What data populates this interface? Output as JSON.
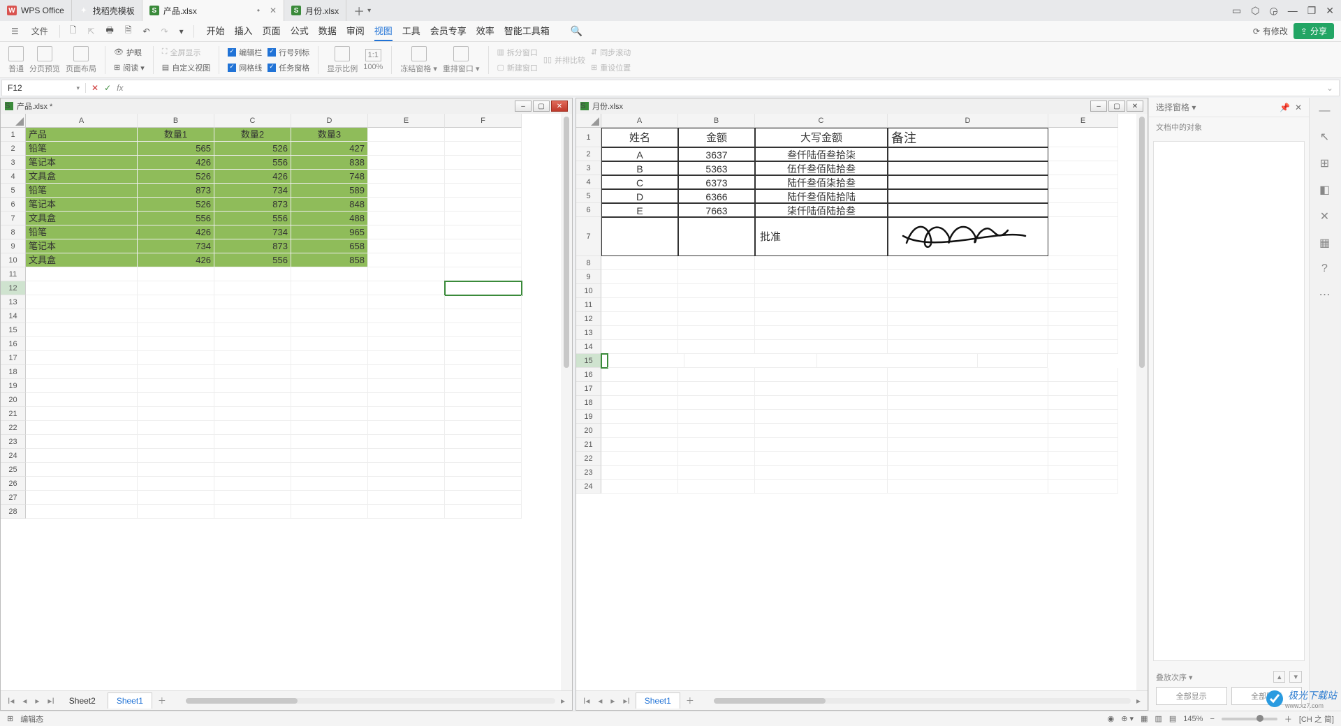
{
  "appTabs": {
    "t0": "WPS Office",
    "t1": "找稻壳模板",
    "t2": "产品.xlsx",
    "t3": "月份.xlsx",
    "dirty2": "•"
  },
  "windowIcons": {
    "min": "—",
    "restore": "❐",
    "close": "✕",
    "help": "?",
    "cube": "⬚",
    "person": "◐",
    "app": "▢"
  },
  "fileMenu": "文件",
  "menuTabs": {
    "m0": "开始",
    "m1": "插入",
    "m2": "页面",
    "m3": "公式",
    "m4": "数据",
    "m5": "审阅",
    "m6": "视图",
    "m7": "工具",
    "m8": "会员专享",
    "m9": "效率",
    "m10": "智能工具箱"
  },
  "rightBtns": {
    "changes": "有修改",
    "share": "分享"
  },
  "ribbon": {
    "g1": {
      "a": "普通",
      "b": "分页预览",
      "c": "页面布局"
    },
    "g2": {
      "a": "护眼",
      "b": "阅读 ▾"
    },
    "g3": {
      "a": "全屏显示",
      "b": "自定义视图"
    },
    "g4": {
      "a": "编辑栏",
      "b": "行号列标",
      "c": "网格线",
      "d": "任务窗格"
    },
    "g5": {
      "a": "显示比例",
      "b": "100%"
    },
    "g6": {
      "a": "冻结窗格 ▾",
      "b": "重排窗口 ▾"
    },
    "g7": {
      "a": "拆分窗口",
      "b": "新建窗口",
      "c": "并排比较",
      "d": "同步滚动",
      "e": "重设位置"
    }
  },
  "namebox": "F12",
  "fx": "fx",
  "doc1": {
    "title": "产品.xlsx *",
    "cols": {
      "A": "A",
      "B": "B",
      "C": "C",
      "D": "D",
      "E": "E",
      "F": "F"
    },
    "header": {
      "A": "产品",
      "B": "数量1",
      "C": "数量2",
      "D": "数量3"
    },
    "rows": [
      {
        "A": "铅笔",
        "B": "565",
        "C": "526",
        "D": "427"
      },
      {
        "A": "笔记本",
        "B": "426",
        "C": "556",
        "D": "838"
      },
      {
        "A": "文具盒",
        "B": "526",
        "C": "426",
        "D": "748"
      },
      {
        "A": "铅笔",
        "B": "873",
        "C": "734",
        "D": "589"
      },
      {
        "A": "笔记本",
        "B": "526",
        "C": "873",
        "D": "848"
      },
      {
        "A": "文具盒",
        "B": "556",
        "C": "556",
        "D": "488"
      },
      {
        "A": "铅笔",
        "B": "426",
        "C": "734",
        "D": "965"
      },
      {
        "A": "笔记本",
        "B": "734",
        "C": "873",
        "D": "658"
      },
      {
        "A": "文具盒",
        "B": "426",
        "C": "556",
        "D": "858"
      }
    ],
    "sheets": {
      "s1": "Sheet2",
      "s2": "Sheet1"
    }
  },
  "doc2": {
    "title": "月份.xlsx",
    "cols": {
      "A": "A",
      "B": "B",
      "C": "C",
      "D": "D",
      "E": "E"
    },
    "header": {
      "A": "姓名",
      "B": "金额",
      "C": "大写金额",
      "D": "备注"
    },
    "rows": [
      {
        "A": "A",
        "B": "3637",
        "C": "叁仟陆佰叁拾柒"
      },
      {
        "A": "B",
        "B": "5363",
        "C": "伍仟叁佰陆拾叁"
      },
      {
        "A": "C",
        "B": "6373",
        "C": "陆仟叁佰柒拾叁"
      },
      {
        "A": "D",
        "B": "6366",
        "C": "陆仟叁佰陆拾陆"
      },
      {
        "A": "E",
        "B": "7663",
        "C": "柒仟陆佰陆拾叁"
      }
    ],
    "approve": "批准",
    "sheets": {
      "s1": "Sheet1"
    }
  },
  "rightPanel": {
    "title": "选择窗格 ▾",
    "sub": "文档中的对象",
    "order": "叠放次序 ▾",
    "btn1": "全部显示",
    "btn2": "全部隐藏"
  },
  "status": {
    "left1": "编辑态",
    "zoom": "145%",
    "ime": "[CH 之 简]"
  },
  "watermark": {
    "brand": "极光下载站",
    "url": "www.xz7.com"
  }
}
